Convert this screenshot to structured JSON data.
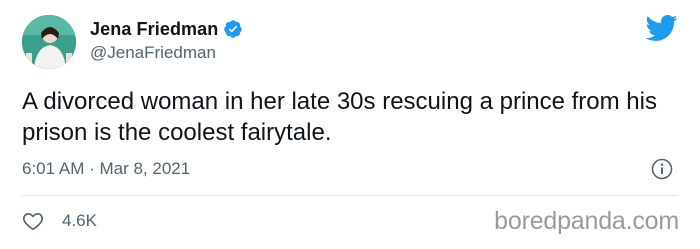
{
  "author": {
    "display_name": "Jena Friedman",
    "handle": "@JenaFriedman",
    "verified": true,
    "avatar_icon": "profile-photo"
  },
  "tweet": {
    "text": "A divorced woman in her late 30s rescuing a prince from his prison is the coolest fairytale.",
    "timestamp": "6:01 AM · Mar 8, 2021",
    "likes": "4.6K"
  },
  "icons": {
    "brand": "twitter-bird-icon",
    "verified": "verified-badge-icon",
    "info": "info-icon",
    "like": "heart-icon"
  },
  "colors": {
    "twitter_blue": "#1d9bf0",
    "secondary_text": "#536471",
    "primary_text": "#0f1419",
    "watermark": "#9a9a9a"
  },
  "watermark": "boredpanda.com"
}
